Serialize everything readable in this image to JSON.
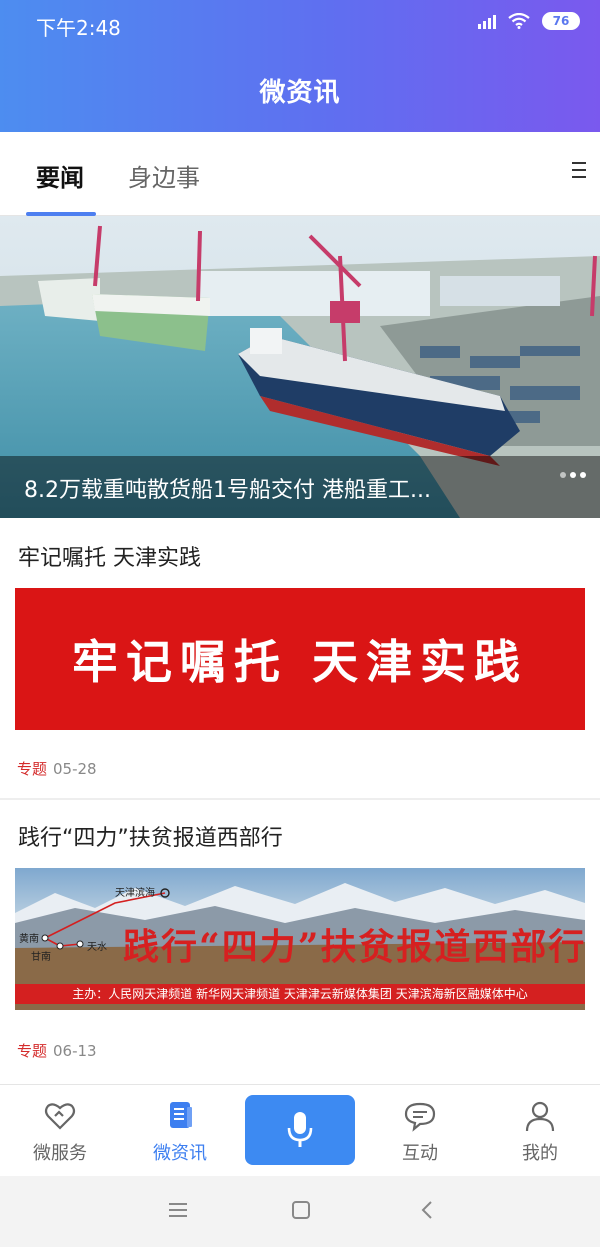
{
  "status_bar": {
    "time": "下午2:48",
    "battery": "76"
  },
  "header": {
    "title": "微资讯"
  },
  "tabs": [
    {
      "label": "要闻",
      "active": true
    },
    {
      "label": "身边事",
      "active": false
    }
  ],
  "hero": {
    "caption": "8.2万载重吨散货船1号船交付 港船重工..."
  },
  "articles": [
    {
      "title": "牢记嘱托 天津实践",
      "banner_text": "牢记嘱托 天津实践",
      "tag": "专题",
      "date": "05-28"
    },
    {
      "title": "践行“四力”扶贫报道西部行",
      "banner_text": "践行“四力”扶贫报道西部行",
      "sponsor": "主办：人民网天津频道   新华网天津频道   天津津云新媒体集团   天津滨海新区融媒体中心",
      "map_labels": [
        "天津滨海",
        "黄南",
        "甘南",
        "天水"
      ],
      "tag": "专题",
      "date": "06-13"
    }
  ],
  "bottom_nav": [
    {
      "label": "微服务",
      "icon": "heart-service-icon"
    },
    {
      "label": "微资讯",
      "icon": "document-icon",
      "active": true
    },
    {
      "label": "",
      "icon": "microphone-icon"
    },
    {
      "label": "互动",
      "icon": "chat-bubble-icon"
    },
    {
      "label": "我的",
      "icon": "user-icon"
    }
  ],
  "colors": {
    "accent": "#3d7ff0",
    "tag_red": "#d42b2b",
    "banner_red": "#da1515"
  }
}
